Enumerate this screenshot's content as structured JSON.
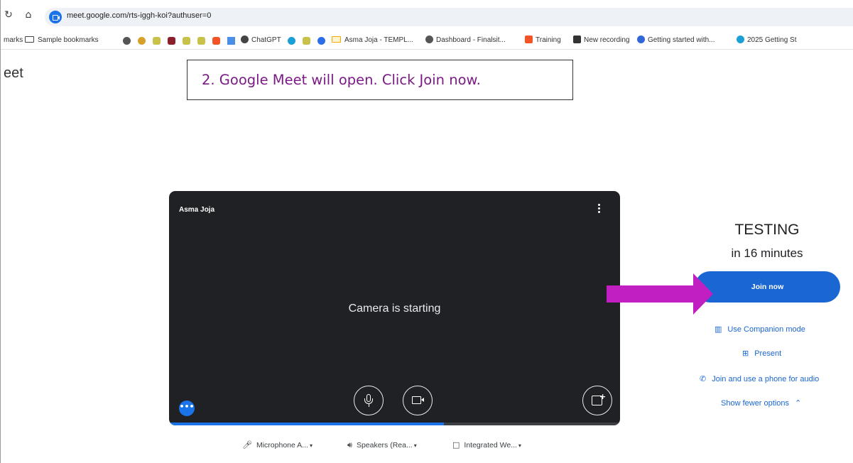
{
  "browser": {
    "url": "meet.google.com/rts-iggh-koi?authuser=0",
    "nav": {
      "reload_icon": "reload-icon",
      "home_icon": "home-icon"
    }
  },
  "bookmarks": [
    "marks",
    "Sample bookmarks",
    "ChatGPT",
    "Asma Joja - TEMPL...",
    "Dashboard - Finalsit...",
    "Training",
    "New recording",
    "Getting started with...",
    "2025 Getting St"
  ],
  "page": {
    "title": "eet"
  },
  "callout": {
    "text": "2. Google Meet will open.  Click Join now."
  },
  "preview": {
    "user_name": "Asma Joja",
    "status": "Camera is starting",
    "more_label": "•••",
    "loading_progress": 0.61
  },
  "devices": {
    "microphone": "Microphone A...",
    "speakers": "Speakers (Rea...",
    "camera": "Integrated We..."
  },
  "meeting": {
    "title": "TESTING",
    "time": "in 16 minutes",
    "join_label": "Join now",
    "companion_label": "Use Companion mode",
    "present_label": "Present",
    "phone_label": "Join and use a phone for audio",
    "fewer_label": "Show fewer options"
  },
  "colors": {
    "accent": "#1a66d2",
    "callout_text": "#7b1a86",
    "arrow": "#c21fc2",
    "preview_bg": "#202124"
  }
}
